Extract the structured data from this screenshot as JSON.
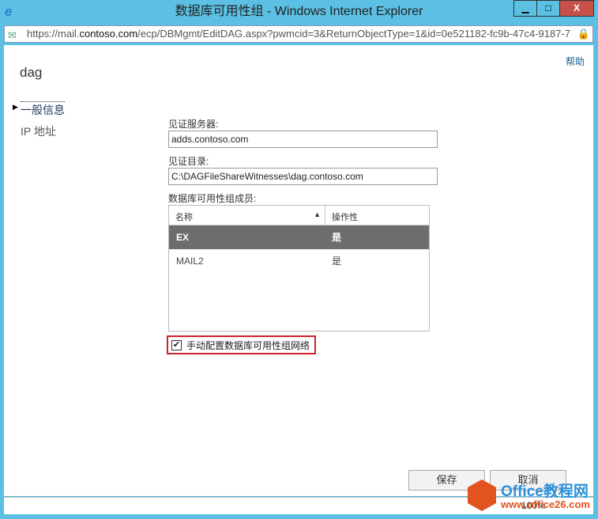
{
  "window": {
    "title": "数据库可用性组 - Windows Internet Explorer",
    "min": "▁",
    "max": "□",
    "close": "X"
  },
  "address": {
    "prefix": "https://mail.",
    "domain": "contoso.com",
    "path": "/ecp/DBMgmt/EditDAG.aspx?pwmcid=3&ReturnObjectType=1&id=0e521182-fc9b-47c4-9187-7"
  },
  "help": "帮助",
  "page_title": "dag",
  "nav": [
    {
      "label": "一般信息"
    },
    {
      "label": "IP 地址"
    }
  ],
  "form": {
    "witness_server_label": "见证服务器:",
    "witness_server": "adds.contoso.com",
    "witness_dir_label": "见证目录:",
    "witness_dir": "C:\\DAGFileShareWitnesses\\dag.contoso.com",
    "members_label": "数据库可用性组成员:",
    "columns": [
      "名称",
      "操作性"
    ],
    "rows": [
      {
        "name": "EX",
        "op": "是"
      },
      {
        "name": "MAIL2",
        "op": "是"
      }
    ],
    "manual_config_label": "手动配置数据库可用性组网络",
    "manual_config_checked": true
  },
  "buttons": {
    "save": "保存",
    "cancel": "取消"
  },
  "status": {
    "zoom": "100%"
  },
  "watermark": {
    "brand": "Office教程网",
    "url": "www.office26.com"
  },
  "colors": {
    "selected_row": "#6d6d6d",
    "highlight_box": "#d0202a",
    "link": "#1a5e8a"
  }
}
